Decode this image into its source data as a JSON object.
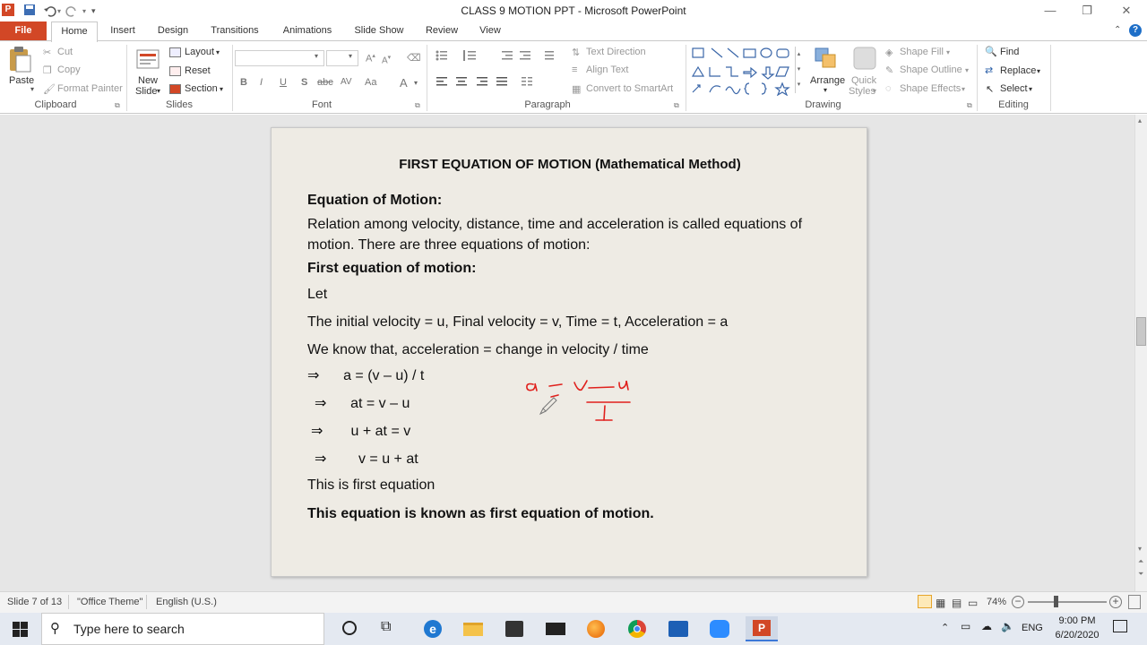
{
  "window": {
    "title": "CLASS 9 MOTION PPT  -  Microsoft PowerPoint",
    "app_icon_letter": "P"
  },
  "tabs": [
    "File",
    "Home",
    "Insert",
    "Design",
    "Transitions",
    "Animations",
    "Slide Show",
    "Review",
    "View"
  ],
  "ribbon": {
    "clipboard": {
      "paste": "Paste",
      "cut": "Cut",
      "copy": "Copy",
      "format_painter": "Format Painter",
      "label": "Clipboard"
    },
    "slides": {
      "new_slide_line1": "New",
      "new_slide_line2": "Slide",
      "layout": "Layout",
      "reset": "Reset",
      "section": "Section",
      "label": "Slides"
    },
    "font": {
      "label": "Font",
      "bold": "B",
      "italic": "I",
      "underline": "U",
      "shadow": "S",
      "strike": "abc",
      "spacing": "AV",
      "case": "Aa",
      "color": "A"
    },
    "paragraph": {
      "text_direction": "Text Direction",
      "align_text": "Align Text",
      "convert_smartart": "Convert to SmartArt",
      "label": "Paragraph"
    },
    "drawing": {
      "arrange": "Arrange",
      "quick_styles_line1": "Quick",
      "quick_styles_line2": "Styles",
      "shape_fill": "Shape Fill",
      "shape_outline": "Shape Outline",
      "shape_effects": "Shape Effects",
      "label": "Drawing"
    },
    "editing": {
      "find": "Find",
      "replace": "Replace",
      "select": "Select",
      "label": "Editing"
    }
  },
  "slide": {
    "title": "FIRST EQUATION OF MOTION (Mathematical Method)",
    "lines": [
      "Equation of Motion:",
      "Relation among velocity, distance, time and acceleration is called equations of",
      "motion. There are three equations of motion:",
      "First equation of motion:",
      "Let",
      "The initial velocity = u, Final velocity = v, Time = t, Acceleration = a",
      "We know that, acceleration = change in velocity / time",
      "⇒      a = (v – u) / t",
      "⇒      at = v – u",
      "⇒       u + at = v",
      "⇒        v = u + at",
      "This is first equation",
      "This equation is known as first equation of motion."
    ]
  },
  "status": {
    "slide_info": "Slide 7 of 13",
    "theme": "\"Office Theme\"",
    "language": "English (U.S.)",
    "zoom": "74%"
  },
  "taskbar": {
    "search_placeholder": "Type here to search",
    "language": "ENG",
    "time": "9:00 PM",
    "date": "6/20/2020"
  },
  "colors": {
    "accent": "#d24726",
    "ink": "#e0201c"
  }
}
